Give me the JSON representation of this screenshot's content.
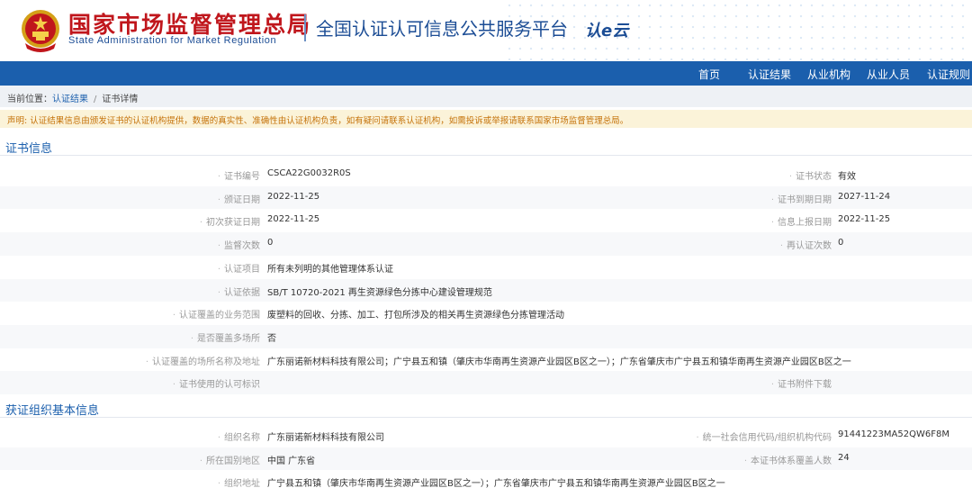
{
  "header": {
    "title_cn": "国家市场监督管理总局",
    "title_en": "State Administration  for  Market Regulation",
    "platform": "全国认证认可信息公共服务平台",
    "logo_text": "认e云"
  },
  "nav": {
    "items": [
      "首页",
      "认证结果",
      "从业机构",
      "从业人员",
      "认证规则"
    ]
  },
  "breadcrumb": {
    "prefix": "当前位置：",
    "items": [
      "认证结果",
      "证书详情"
    ],
    "separator": "/"
  },
  "notice": "声明: 认证结果信息由颁发证书的认证机构提供，数据的真实性、准确性由认证机构负责，如有疑问请联系认证机构，如需投诉或举报请联系国家市场监督管理总局。",
  "cert_section": {
    "title": "证书信息",
    "rows": [
      {
        "left_label": "证书编号",
        "left_value": "CSCA22G0032R0S",
        "right_label": "证书状态",
        "right_value": "有效"
      },
      {
        "left_label": "颁证日期",
        "left_value": "2022-11-25",
        "right_label": "证书到期日期",
        "right_value": "2027-11-24"
      },
      {
        "left_label": "初次获证日期",
        "left_value": "2022-11-25",
        "right_label": "信息上报日期",
        "right_value": "2022-11-25"
      },
      {
        "left_label": "监督次数",
        "left_value": "0",
        "right_label": "再认证次数",
        "right_value": "0"
      },
      {
        "left_label": "认证项目",
        "left_value": "所有未列明的其他管理体系认证"
      },
      {
        "left_label": "认证依据",
        "left_value": "SB/T 10720-2021 再生资源绿色分拣中心建设管理规范"
      },
      {
        "left_label": "认证覆盖的业务范围",
        "left_value": "废塑料的回收、分拣、加工、打包所涉及的相关再生资源绿色分拣管理活动"
      },
      {
        "left_label": "是否覆盖多场所",
        "left_value": "否"
      },
      {
        "left_label": "认证覆盖的场所名称及地址",
        "left_value": "广东丽诺新材料科技有限公司；广宁县五和镇（肇庆市华南再生资源产业园区B区之一）；广东省肇庆市广宁县五和镇华南再生资源产业园区B区之一"
      },
      {
        "left_label": "证书使用的认可标识",
        "left_value": "",
        "right_label": "证书附件下载",
        "right_value": ""
      }
    ]
  },
  "org_section": {
    "title": "获证组织基本信息",
    "rows": [
      {
        "left_label": "组织名称",
        "left_value": "广东丽诺新材料科技有限公司",
        "right_label": "统一社会信用代码/组织机构代码",
        "right_value": "91441223MA52QW6F8M"
      },
      {
        "left_label": "所在国别地区",
        "left_value": "中国 广东省",
        "right_label": "本证书体系覆盖人数",
        "right_value": "24"
      },
      {
        "left_label": "组织地址",
        "left_value": "广宁县五和镇（肇庆市华南再生资源产业园区B区之一）；广东省肇庆市广宁县五和镇华南再生资源产业园区B区之一"
      }
    ]
  },
  "colors": {
    "brand_red": "#c0161c",
    "nav_blue": "#1b5fad",
    "notice_text": "#c5730b"
  }
}
